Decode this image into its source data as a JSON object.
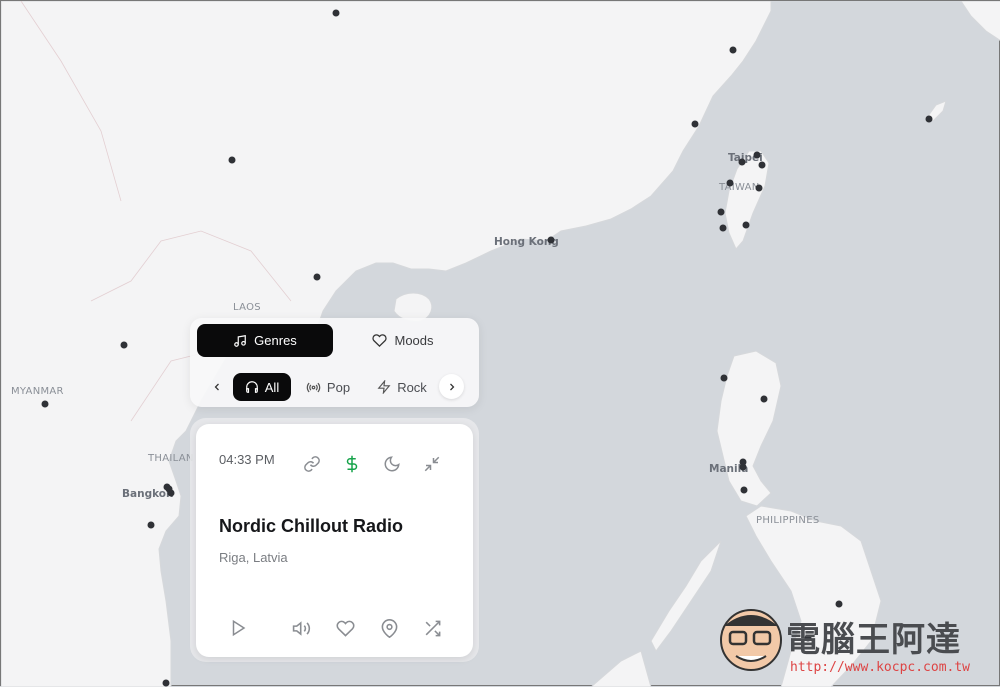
{
  "map": {
    "labels": {
      "laos": "LAOS",
      "myanmar": "MYANMAR",
      "thailand": "THAILAN",
      "bangkok": "Bangkok",
      "hongkong": "Hong Kong",
      "taipei": "Taipei",
      "taiwan": "TAIWAN",
      "manila": "Manila",
      "philippines": "PHILIPPINES"
    }
  },
  "panel": {
    "segments": {
      "genres": "Genres",
      "moods": "Moods"
    },
    "chips": {
      "all": "All",
      "pop": "Pop",
      "rock": "Rock"
    }
  },
  "card": {
    "time": "04:33 PM",
    "station_name": "Nordic Chillout Radio",
    "location": "Riga, Latvia",
    "accent_color": "#16a34a"
  },
  "watermark": {
    "text": "電腦王阿達",
    "url": "http://www.kocpc.com.tw"
  }
}
